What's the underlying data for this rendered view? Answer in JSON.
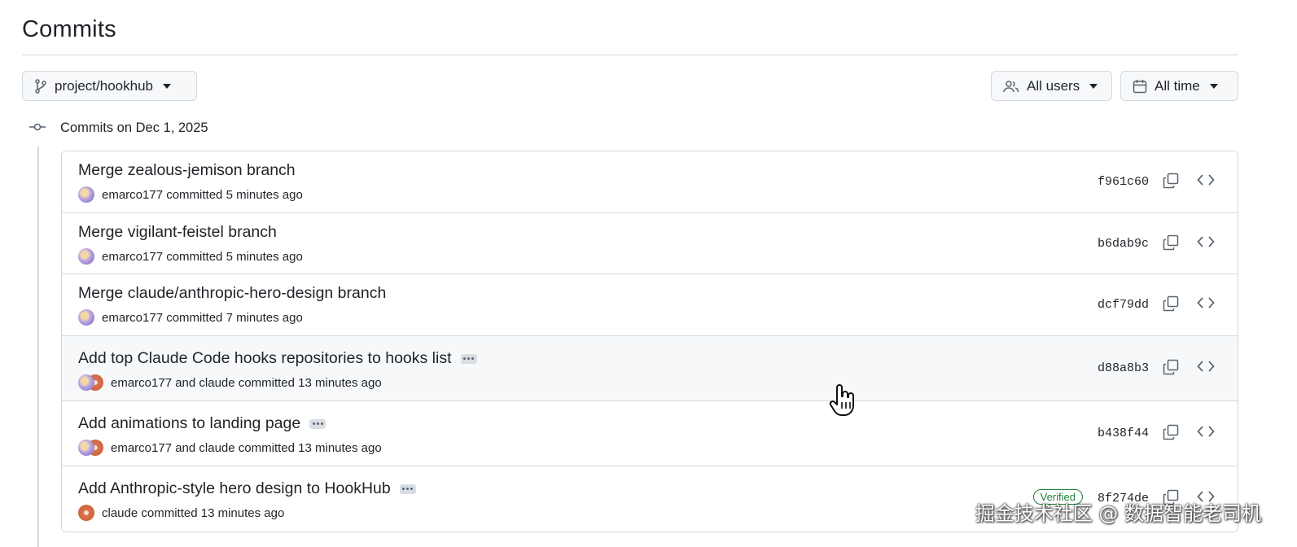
{
  "page": {
    "title": "Commits"
  },
  "toolbar": {
    "branch": {
      "label": "project/hookhub",
      "icon": "git-branch-icon"
    },
    "users_filter": {
      "label": "All users",
      "icon": "people-icon"
    },
    "time_filter": {
      "label": "All time",
      "icon": "calendar-icon"
    }
  },
  "group": {
    "label": "Commits on Dec 1, 2025"
  },
  "commits": [
    {
      "message": "Merge zealous-jemison branch",
      "authors": "emarco177",
      "committed": "committed 5 minutes ago",
      "sha": "f961c60",
      "has_ellipsis": false,
      "verified": false
    },
    {
      "message": "Merge vigilant-feistel branch",
      "authors": "emarco177",
      "committed": "committed 5 minutes ago",
      "sha": "b6dab9c",
      "has_ellipsis": false,
      "verified": false
    },
    {
      "message": "Merge claude/anthropic-hero-design branch",
      "authors": "emarco177",
      "committed": "committed 7 minutes ago",
      "sha": "dcf79dd",
      "has_ellipsis": false,
      "verified": false
    },
    {
      "message": "Add top Claude Code hooks repositories to hooks list",
      "authors": "emarco177 and claude",
      "committed": "committed 13 minutes ago",
      "sha": "d88a8b3",
      "has_ellipsis": true,
      "verified": false
    },
    {
      "message": "Add animations to landing page",
      "authors": "emarco177 and claude",
      "committed": "committed 13 minutes ago",
      "sha": "b438f44",
      "has_ellipsis": true,
      "verified": false
    },
    {
      "message": "Add Anthropic-style hero design to HookHub",
      "authors": "claude",
      "committed": "committed 13 minutes ago",
      "sha": "8f274de",
      "has_ellipsis": true,
      "verified": true,
      "verified_label": "Verified"
    }
  ],
  "watermark": "掘金技术社区 @ 数据智能老司机",
  "colors": {
    "border": "#d1d9e0",
    "verified": "#1a7f37",
    "hover_row": "#f6f8fa"
  }
}
